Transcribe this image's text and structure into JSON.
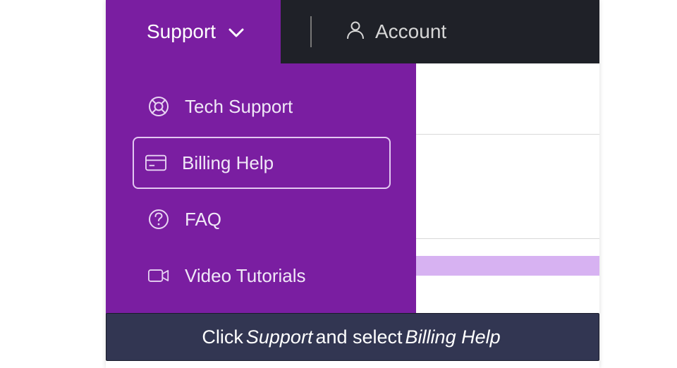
{
  "nav": {
    "support_label": "Support",
    "account_label": "Account"
  },
  "dropdown": {
    "items": [
      {
        "label": "Tech Support",
        "icon": "lifebuoy-icon",
        "highlighted": false
      },
      {
        "label": "Billing Help",
        "icon": "card-icon",
        "highlighted": true
      },
      {
        "label": "FAQ",
        "icon": "question-circle-icon",
        "highlighted": false
      },
      {
        "label": "Video Tutorials",
        "icon": "video-icon",
        "highlighted": false
      }
    ]
  },
  "caption": {
    "prefix": "Click ",
    "em1": "Support",
    "mid": " and select ",
    "em2": "Billing Help"
  },
  "colors": {
    "primary": "#7a1ea1",
    "nav_bg": "#1f2128",
    "caption_bg": "#323652",
    "highlight_stripe": "#d7b2f2"
  }
}
